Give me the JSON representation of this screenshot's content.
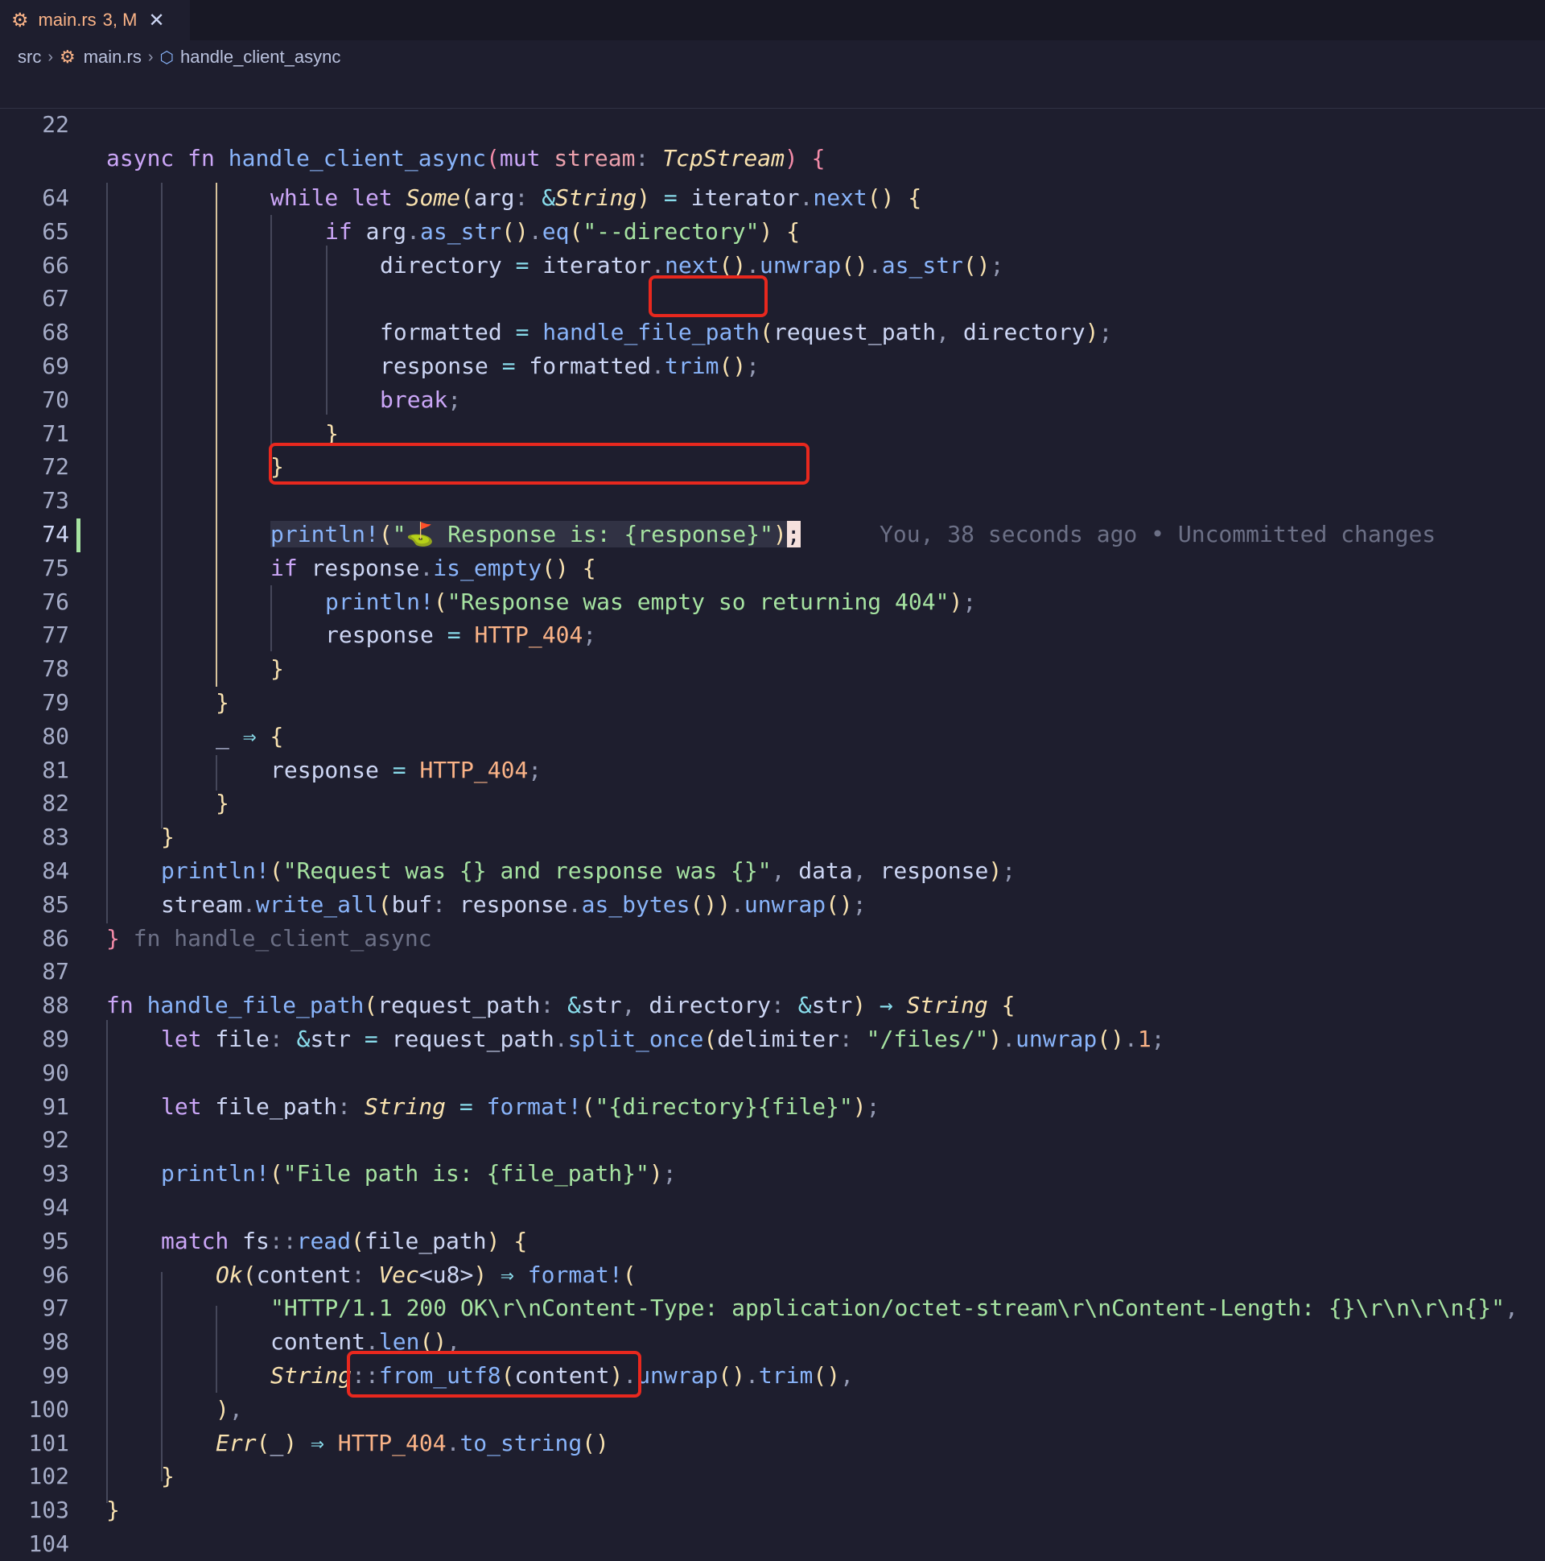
{
  "tab": {
    "filename": "main.rs",
    "badge": "3, M",
    "close": "✕"
  },
  "breadcrumb": {
    "folder": "src",
    "file": "main.rs",
    "symbol": "handle_client_async"
  },
  "sticky": {
    "number": "22",
    "text": "async fn handle_client_async(mut stream: TcpStream) {"
  },
  "blame": "You, 38 seconds ago • Uncommitted changes",
  "line_numbers": [
    "64",
    "65",
    "66",
    "67",
    "68",
    "69",
    "70",
    "71",
    "72",
    "73",
    "74",
    "75",
    "76",
    "77",
    "78",
    "79",
    "80",
    "81",
    "82",
    "83",
    "84",
    "85",
    "86",
    "87",
    "88",
    "89",
    "90",
    "91",
    "92",
    "93",
    "94",
    "95",
    "96",
    "97",
    "98",
    "99",
    "100",
    "101",
    "102",
    "103",
    "104"
  ],
  "code_lines": [
    "while let Some(arg: &String) = iterator.next() {",
    "if arg.as_str().eq(\"--directory\") {",
    "directory = iterator.next().unwrap().as_str();",
    "",
    "formatted = handle_file_path(request_path, directory);",
    "response = formatted.trim();",
    "break;",
    "}",
    "}",
    "",
    "println!(\"⛳ Response is: {response}\");",
    "if response.is_empty() {",
    "println!(\"Response was empty so returning 404\");",
    "response = HTTP_404;",
    "}",
    "}",
    "_ ⇒ {",
    "response = HTTP_404;",
    "}",
    "}",
    "println!(\"Request was {} and response was {}\", data, response);",
    "stream.write_all(buf: response.as_bytes()).unwrap();",
    "} fn handle_client_async",
    "",
    "fn handle_file_path(request_path: &str, directory: &str) → String {",
    "let file: &str = request_path.split_once(delimiter: \"/files/\").unwrap().1;",
    "",
    "let file_path: String = format!(\"{directory}{file}\");",
    "",
    "println!(\"File path is: {file_path}\");",
    "",
    "match fs::read(file_path) {",
    "Ok(content: Vec<u8>) ⇒ format!(",
    "\"HTTP/1.1 200 OK\\r\\nContent-Type: application/octet-stream\\r\\nContent-Length: {}\\r\\n\\r\\n{}\",",
    "content.len(),",
    "String::from_utf8(content).unwrap().trim(),",
    "),",
    "Err(_) ⇒ HTTP_404.to_string()",
    "}",
    "}",
    ""
  ],
  "colors": {
    "background": "#1e1e2e",
    "highlight_box": "#e8281e",
    "git_added": "#a6e3a1",
    "accent_orange": "#fab387"
  },
  "icons": [
    "rust-icon",
    "close-icon",
    "chevron-right-icon",
    "symbol-cube-icon"
  ]
}
